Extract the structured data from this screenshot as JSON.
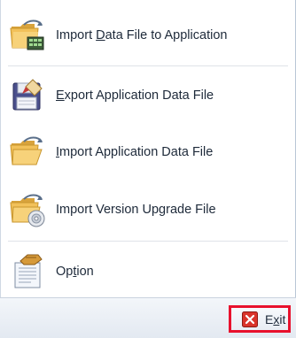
{
  "menu": {
    "items": [
      {
        "pre": "Import ",
        "mn": "D",
        "post": "ata File to Application",
        "icon": "folder-data-icon"
      },
      {
        "pre": "",
        "mn": "E",
        "post": "xport Application Data File",
        "icon": "floppy-save-icon"
      },
      {
        "pre": "",
        "mn": "I",
        "post": "mport Application Data File",
        "icon": "open-folder-icon"
      },
      {
        "pre": "Import Version Upgrade File",
        "mn": "",
        "post": "",
        "icon": "folder-cd-icon"
      },
      {
        "pre": "Op",
        "mn": "t",
        "post": "ion",
        "icon": "options-document-icon"
      }
    ]
  },
  "footer": {
    "exit": {
      "pre": "E",
      "mn": "x",
      "post": "it",
      "icon": "close-x-icon"
    }
  },
  "colors": {
    "exit_highlight": "#e8112d",
    "folder": "#f0b84a",
    "text": "#1e2a3a"
  }
}
